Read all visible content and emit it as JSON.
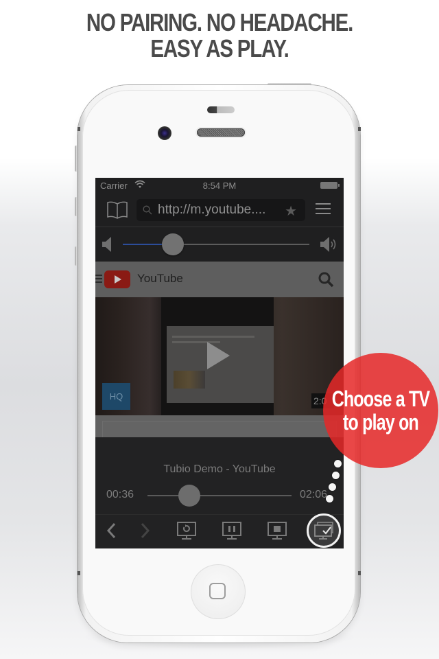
{
  "headline": {
    "line1": "NO PAIRING. NO HEADACHE.",
    "line2": "EASY AS PLAY."
  },
  "status_bar": {
    "carrier": "Carrier",
    "time": "8:54 PM",
    "wifi_icon": "wifi-icon",
    "battery_icon": "battery-icon"
  },
  "browser": {
    "bookmarks_icon": "book-icon",
    "url": "http://m.youtube....",
    "search_icon": "search-icon",
    "favorite_icon": "star-icon",
    "menu_icon": "hamburger-icon"
  },
  "volume": {
    "level": 0.27,
    "low_icon": "speaker-low-icon",
    "high_icon": "speaker-high-icon",
    "fill_color": "#2c4d9a"
  },
  "webpage": {
    "site_title": "YouTube",
    "logo": "youtube-logo-icon",
    "search_icon": "search-icon",
    "hq_badge": "HQ",
    "duration": "2:0",
    "play_icon": "play-icon"
  },
  "player": {
    "title": "Tubio Demo - YouTube",
    "current_time": "00:36",
    "total_time": "02:06",
    "progress": 0.29,
    "controls": [
      {
        "name": "back-icon"
      },
      {
        "name": "forward-icon"
      },
      {
        "name": "replay-on-tv-icon"
      },
      {
        "name": "pause-on-tv-icon"
      },
      {
        "name": "stop-on-tv-icon"
      },
      {
        "name": "choose-tv-icon"
      }
    ]
  },
  "callout": {
    "line1": "Choose a TV",
    "line2": "to play on",
    "color": "#e62828"
  }
}
